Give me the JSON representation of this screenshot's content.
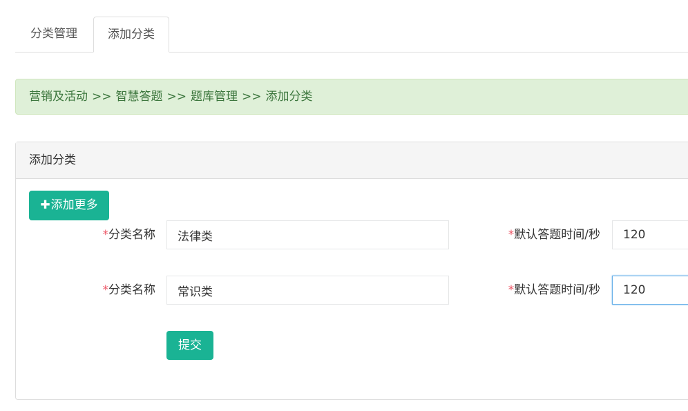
{
  "tabs": [
    {
      "label": "分类管理"
    },
    {
      "label": "添加分类"
    }
  ],
  "breadcrumb": {
    "items": [
      "营销及活动",
      "智慧答题",
      "题库管理",
      "添加分类"
    ],
    "separator": ">>"
  },
  "panel": {
    "title": "添加分类",
    "add_more_button": {
      "icon": "plus-icon",
      "label": "添加更多"
    },
    "rows": [
      {
        "name_label": "分类名称",
        "name_value": "法律类",
        "time_label": "默认答题时间/秒",
        "time_value": "120"
      },
      {
        "name_label": "分类名称",
        "name_value": "常识类",
        "time_label": "默认答题时间/秒",
        "time_value": "120"
      }
    ],
    "required_mark": "*",
    "submit_label": "提交"
  },
  "colors": {
    "primary": "#1ab394",
    "breadcrumb_bg": "#dff0d8",
    "breadcrumb_text": "#3c763d",
    "required": "#ed5565"
  }
}
